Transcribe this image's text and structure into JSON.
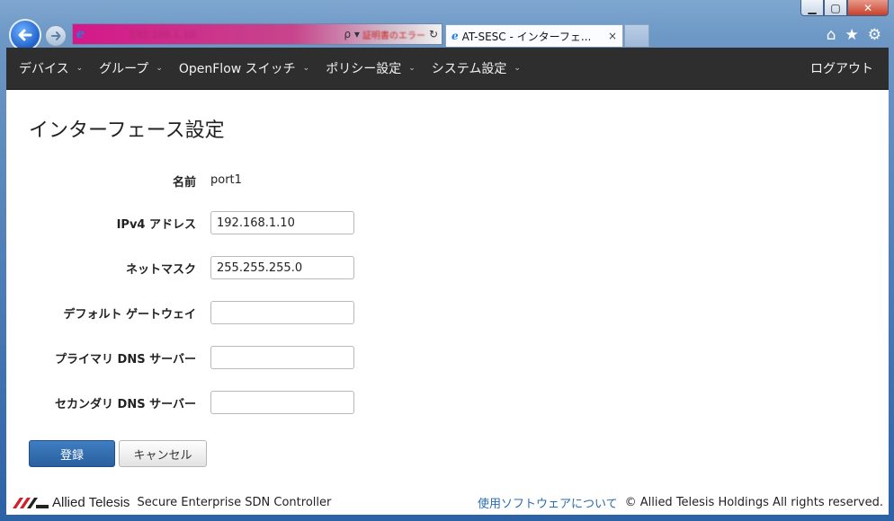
{
  "browser": {
    "tab_title": "AT-SESC - インターフェ...",
    "tab_close": "×",
    "address_url": "192.168.1.10",
    "search_glyph": "ρ ▾",
    "cert_text": "証明書のエラー",
    "refresh_glyph": "↻",
    "ie_glyph": "e",
    "window_buttons": {
      "minimize": "▁",
      "maximize": "▢",
      "close": "✕"
    },
    "tools": {
      "home": "⌂",
      "favorites": "★",
      "settings": "⚙"
    }
  },
  "nav": {
    "items": [
      {
        "label": "デバイス"
      },
      {
        "label": "グループ"
      },
      {
        "label": "OpenFlow スイッチ"
      },
      {
        "label": "ポリシー設定"
      },
      {
        "label": "システム設定"
      }
    ],
    "caret": "⌄",
    "logout": "ログアウト"
  },
  "page": {
    "title": "インターフェース設定",
    "fields": {
      "name": {
        "label": "名前",
        "value": "port1"
      },
      "ipv4": {
        "label": "IPv4 アドレス",
        "value": "192.168.1.10"
      },
      "netmask": {
        "label": "ネットマスク",
        "value": "255.255.255.0"
      },
      "gateway": {
        "label": "デフォルト ゲートウェイ",
        "value": ""
      },
      "dns_primary": {
        "label": "プライマリ DNS サーバー",
        "value": ""
      },
      "dns_secondary": {
        "label": "セカンダリ DNS サーバー",
        "value": ""
      }
    },
    "submit_label": "登録",
    "cancel_label": "キャンセル"
  },
  "footer": {
    "logo_text": "Allied Telesis",
    "product": "Secure Enterprise SDN Controller",
    "software_link": "使用ソフトウェアについて",
    "copyright": "© Allied Telesis Holdings All rights reserved."
  },
  "colors": {
    "navbar": "#2e2e2e",
    "primary_button": "#2f6aab",
    "link": "#2a6bb0",
    "logo_red": "#d0202a"
  }
}
